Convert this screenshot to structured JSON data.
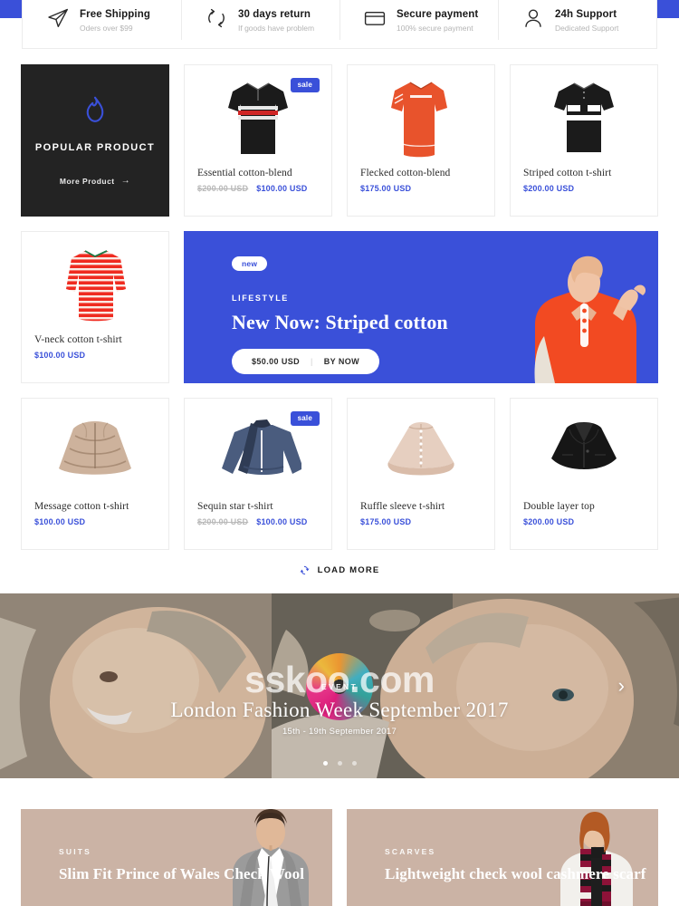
{
  "services": [
    {
      "icon": "paper-plane-icon",
      "title": "Free Shipping",
      "subtitle": "Oders over $99"
    },
    {
      "icon": "refresh-return-icon",
      "title": "30 days return",
      "subtitle": "If goods have problem"
    },
    {
      "icon": "credit-card-icon",
      "title": "Secure payment",
      "subtitle": "100% secure payment"
    },
    {
      "icon": "user-support-icon",
      "title": "24h Support",
      "subtitle": "Dedicated Support"
    }
  ],
  "popular": {
    "icon": "flame-icon",
    "title": "POPULAR PRODUCT",
    "more_label": "More Product",
    "more_arrow": "→"
  },
  "products": [
    {
      "name": "Essential cotton-blend",
      "old_price": "$200.00 USD",
      "price": "$100.00 USD",
      "badge": "sale",
      "image": "black-striped-tee"
    },
    {
      "name": "Flecked cotton-blend",
      "old_price": "",
      "price": "$175.00 USD",
      "badge": "",
      "image": "orange-tee"
    },
    {
      "name": "Striped cotton t-shirt",
      "old_price": "",
      "price": "$200.00 USD",
      "badge": "",
      "image": "black-white-polo"
    },
    {
      "name": "V-neck cotton t-shirt",
      "old_price": "",
      "price": "$100.00 USD",
      "badge": "",
      "image": "red-striped-top"
    },
    {
      "name": "Message cotton t-shirt",
      "old_price": "",
      "price": "$100.00 USD",
      "badge": "",
      "image": "beige-ruffle-skirt"
    },
    {
      "name": "Sequin star t-shirt",
      "old_price": "$200.00 USD",
      "price": "$100.00 USD",
      "badge": "sale",
      "image": "navy-sweater"
    },
    {
      "name": "Ruffle sleeve t-shirt",
      "old_price": "",
      "price": "$175.00 USD",
      "badge": "",
      "image": "blush-cape"
    },
    {
      "name": "Double layer top",
      "old_price": "",
      "price": "$200.00 USD",
      "badge": "",
      "image": "black-cape-jacket"
    }
  ],
  "lifestyle": {
    "pill": "new",
    "kicker": "LIFESTYLE",
    "headline": "New Now: Striped cotton",
    "price": "$50.00 USD",
    "separator": "|",
    "cta": "BY NOW"
  },
  "load_more": {
    "icon": "refresh-icon",
    "label": "LOAD MORE"
  },
  "hero": {
    "kicker": "EVENT",
    "title": "London Fashion Week September 2017",
    "date": "15th - 19th September 2017",
    "next_arrow": "›",
    "watermark": "sskoo.com",
    "dots": 3,
    "active_dot": 0
  },
  "categories": [
    {
      "kicker": "SUITS",
      "title": "Slim Fit Prince of Wales Check Wool",
      "image": "man-in-grey-suit"
    },
    {
      "kicker": "SCARVES",
      "title": "Lightweight check wool cashmere scarf",
      "image": "woman-with-check-scarf"
    }
  ],
  "colors": {
    "accent": "#3a50d9",
    "dark_tile": "#232323",
    "category_bg": "#cbb3a5",
    "border": "#ececec",
    "muted_text": "#b9b9b9"
  }
}
